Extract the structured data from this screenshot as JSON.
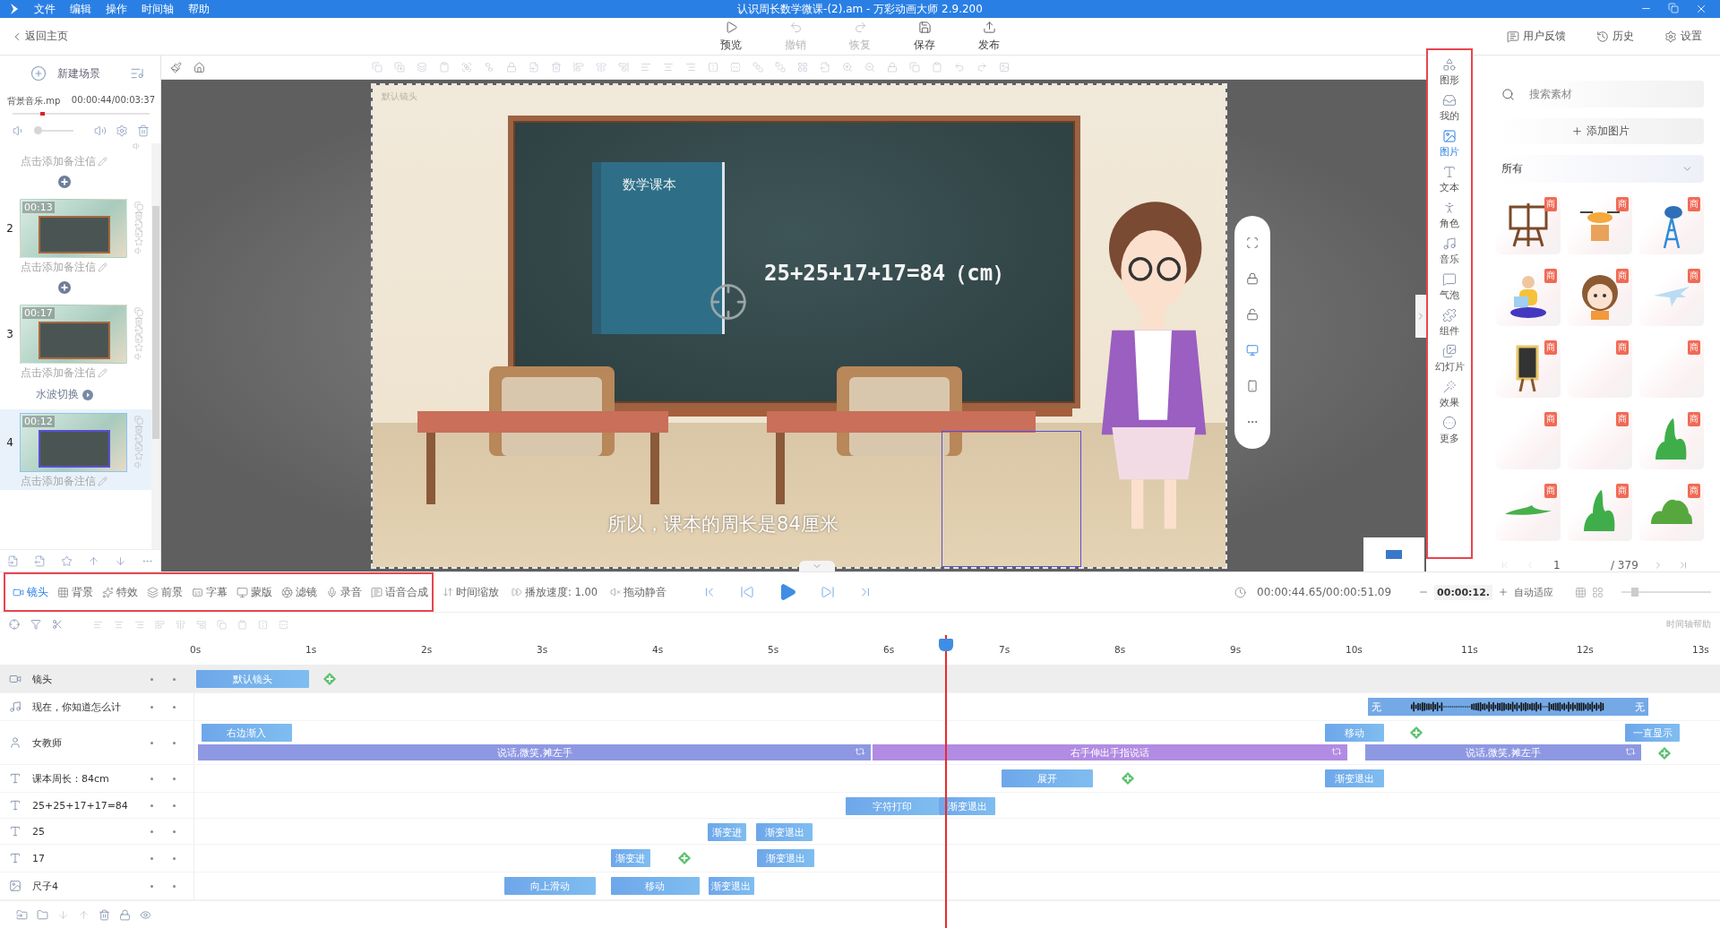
{
  "menu": [
    "文件",
    "编辑",
    "操作",
    "时间轴",
    "帮助"
  ],
  "window": {
    "title": "认识周长数学微课-(2).am - 万彩动画大师 2.9.200"
  },
  "toolbar": {
    "back": "返回主页",
    "actions": [
      {
        "label": "预览",
        "disabled": false
      },
      {
        "label": "撤销",
        "disabled": true
      },
      {
        "label": "恢复",
        "disabled": true
      },
      {
        "label": "保存",
        "disabled": false
      },
      {
        "label": "发布",
        "disabled": false
      }
    ],
    "right": [
      "用户反馈",
      "历史",
      "设置"
    ]
  },
  "scene_panel": {
    "new_scene": "新建场景",
    "music": {
      "name": "背景音乐.mp",
      "time": "00:00:44/00:03:37",
      "level": 0.2
    },
    "volume": {
      "level": 0.1
    },
    "scenes": [
      {
        "note": "点击添加备注信",
        "selected": false
      },
      {
        "number": "2",
        "time": "00:13",
        "note": "点击添加备注信",
        "selected": false
      },
      {
        "number": "3",
        "time": "00:17",
        "note": "点击添加备注信",
        "selected": false,
        "transition": "水波切换"
      },
      {
        "number": "4",
        "time": "00:12",
        "note": "点击添加备注信",
        "selected": true
      }
    ]
  },
  "canvas": {
    "camera_label": "默认镜头",
    "book_title": "数学课本",
    "equation": "25+25+17+17=84（cm）",
    "subtitle": "所以，课本的周长是84厘米"
  },
  "asset_nav": [
    {
      "label": "图形",
      "selected": false
    },
    {
      "label": "我的",
      "selected": false
    },
    {
      "label": "图片",
      "selected": true
    },
    {
      "label": "文本",
      "selected": false
    },
    {
      "label": "角色",
      "selected": false
    },
    {
      "label": "音乐",
      "selected": false
    },
    {
      "label": "气泡",
      "selected": false
    },
    {
      "label": "组件",
      "selected": false
    },
    {
      "label": "幻灯片",
      "selected": false
    },
    {
      "label": "效果",
      "selected": false
    },
    {
      "label": "更多",
      "selected": false
    }
  ],
  "asset_panel": {
    "search": {
      "placeholder": "搜索素材"
    },
    "add_image": "添加图片",
    "filter": "所有",
    "assets": [
      {
        "badge": "商"
      },
      {
        "badge": "商"
      },
      {
        "badge": "商"
      },
      {
        "badge": "商"
      },
      {
        "badge": "商"
      },
      {
        "badge": "商"
      },
      {
        "badge": "商"
      },
      {
        "badge": "商"
      },
      {
        "badge": "商"
      },
      {
        "badge": "商"
      },
      {
        "badge": "商"
      },
      {
        "badge": "商"
      },
      {
        "badge": "商"
      },
      {
        "badge": "商"
      },
      {
        "badge": "商"
      }
    ],
    "page": "1",
    "total": "/ 379"
  },
  "bottom_toolbar": {
    "tools": [
      {
        "label": "镜头",
        "selected": true
      },
      {
        "label": "背景",
        "selected": false
      },
      {
        "label": "特效",
        "selected": false
      },
      {
        "label": "前景",
        "selected": false
      },
      {
        "label": "字幕",
        "selected": false
      },
      {
        "label": "蒙版",
        "selected": false
      },
      {
        "label": "滤镜",
        "selected": false
      },
      {
        "label": "录音",
        "selected": false
      },
      {
        "label": "语音合成",
        "selected": false
      }
    ],
    "extras": [
      "时间缩放",
      "播放速度: 1.00",
      "拖动静音"
    ],
    "time": "00:00:44.65/00:00:51.09",
    "zoom_value": "00:00:12.",
    "auto_fit": "自动适应",
    "zoom": {
      "level": 0.15
    }
  },
  "timeline": {
    "help": "时间轴帮助",
    "ruler": [
      "0s",
      "1s",
      "2s",
      "3s",
      "4s",
      "5s",
      "6s",
      "7s",
      "8s",
      "9s",
      "10s",
      "11s",
      "12s",
      "13s"
    ],
    "tracks": [
      {
        "kind": "camera",
        "name": "镜头",
        "clips": [
          {
            "kind": "motion",
            "label": "默认镜头"
          },
          {
            "kind": "add"
          }
        ]
      },
      {
        "kind": "music",
        "name": "现在，你知道怎么计",
        "clips": [
          {
            "kind": "audio",
            "start_label": "无",
            "end_label": "无"
          }
        ]
      },
      {
        "kind": "character",
        "name": "女教师",
        "clips": [
          {
            "kind": "motion",
            "label": "右边渐入"
          },
          {
            "kind": "motion",
            "label": "移动"
          },
          {
            "kind": "add"
          },
          {
            "kind": "motion",
            "label": "一直显示"
          },
          {
            "kind": "action",
            "label": "说话,微笑,摊左手",
            "color": "#8e98e2"
          },
          {
            "kind": "action",
            "label": "右手伸出手指说话",
            "color": "#b18ce2"
          },
          {
            "kind": "action",
            "label": "说话,微笑,摊左手",
            "color": "#8e98e2"
          },
          {
            "kind": "add"
          }
        ]
      },
      {
        "kind": "text",
        "name": "课本周长：84cm",
        "clips": [
          {
            "kind": "motion",
            "label": "展开"
          },
          {
            "kind": "add"
          },
          {
            "kind": "motion",
            "label": "渐变退出"
          }
        ]
      },
      {
        "kind": "text",
        "name": "25+25+17+17=84",
        "clips": [
          {
            "kind": "motion",
            "label": "字符打印"
          },
          {
            "kind": "motion",
            "label": "渐变退出"
          }
        ]
      },
      {
        "kind": "text",
        "name": "25",
        "clips": [
          {
            "kind": "motion",
            "label": "渐变进"
          },
          {
            "kind": "motion",
            "label": "渐变退出"
          }
        ]
      },
      {
        "kind": "text",
        "name": "17",
        "clips": [
          {
            "kind": "motion",
            "label": "渐变进"
          },
          {
            "kind": "add"
          },
          {
            "kind": "motion",
            "label": "渐变退出"
          }
        ]
      },
      {
        "kind": "image",
        "name": "尺子4",
        "clips": [
          {
            "kind": "motion",
            "label": "向上滑动"
          },
          {
            "kind": "motion",
            "label": "移动"
          },
          {
            "kind": "motion",
            "label": "渐变退出"
          }
        ]
      }
    ]
  }
}
